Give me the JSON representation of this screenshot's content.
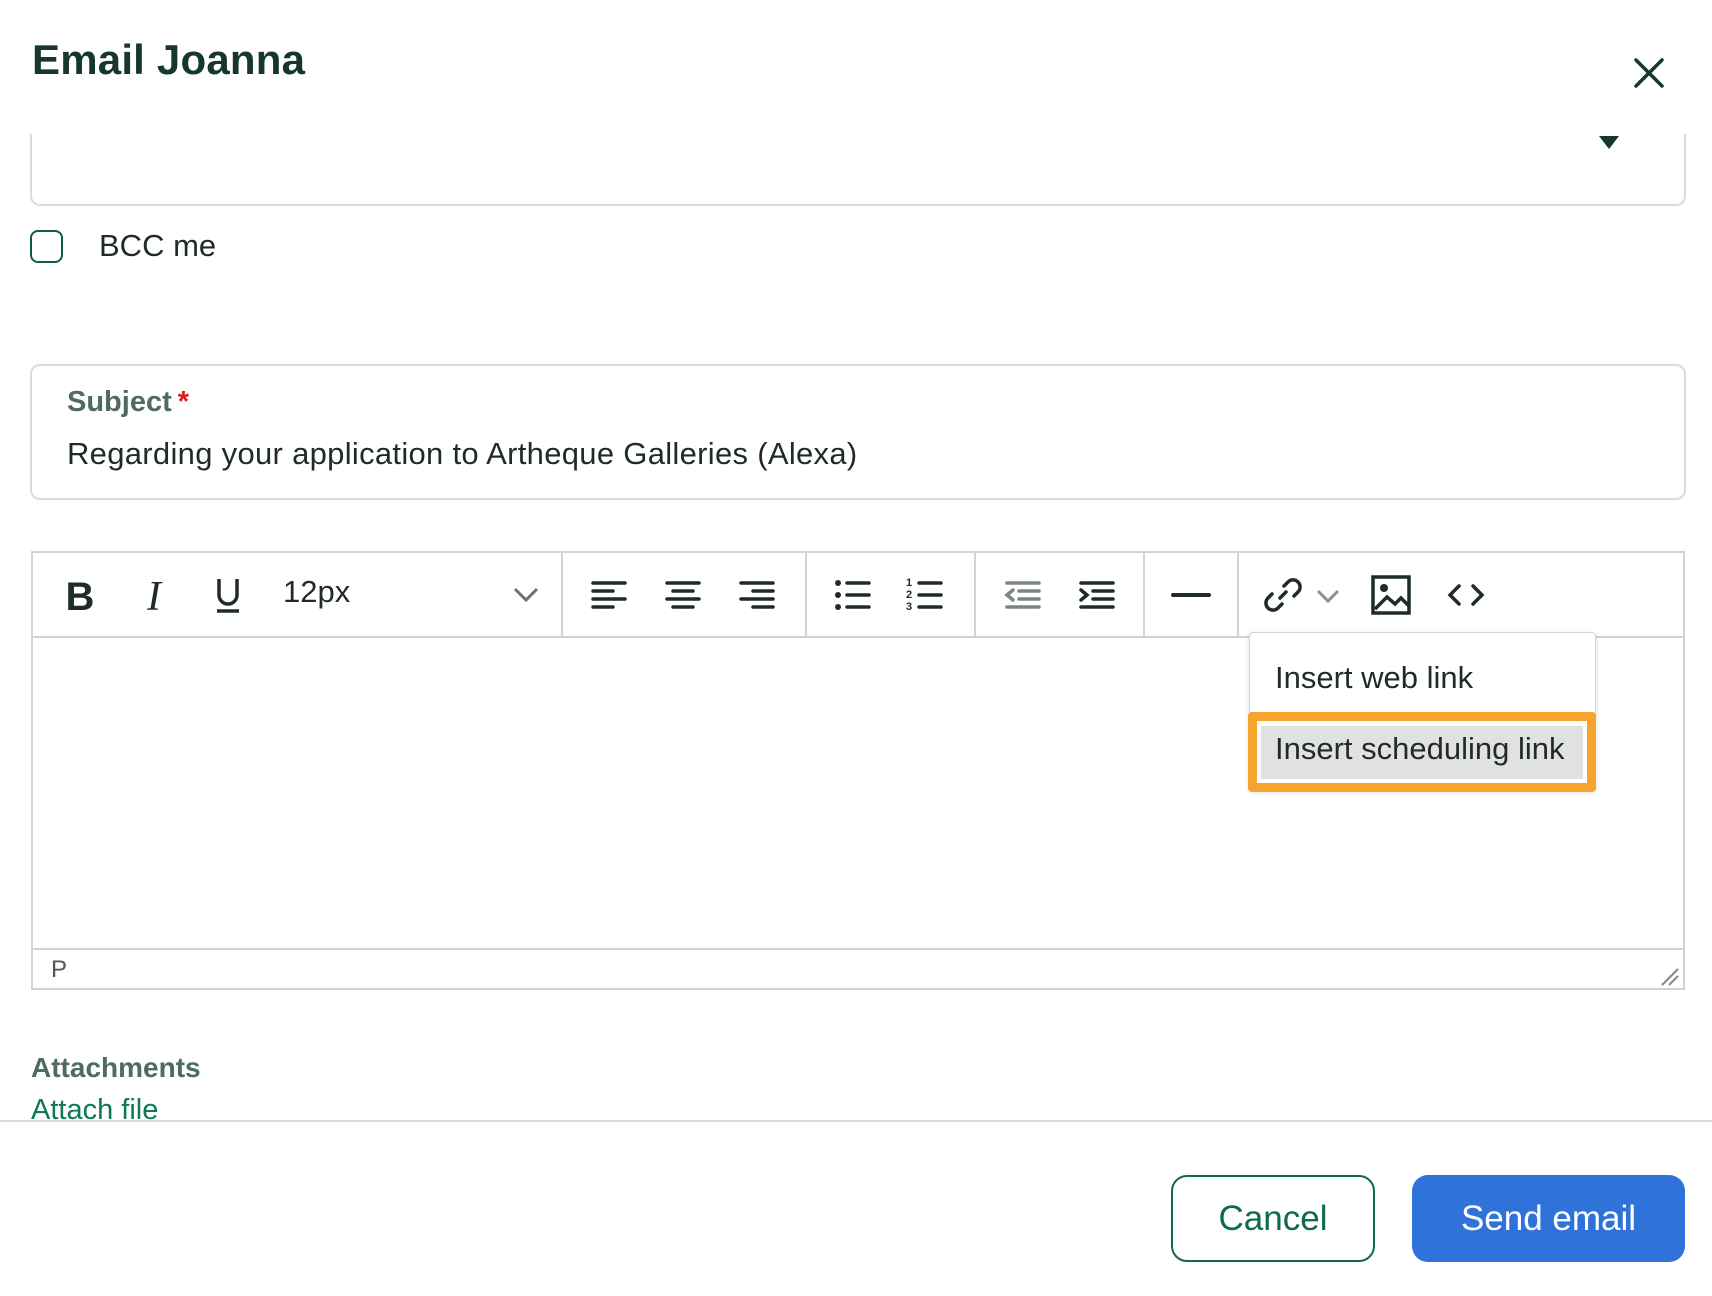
{
  "dialog": {
    "title": "Email Joanna",
    "close_icon": "close-icon"
  },
  "recipient": {
    "caret_icon": "caret-down-icon"
  },
  "bcc": {
    "label": "BCC me",
    "checked": false
  },
  "subject": {
    "label": "Subject",
    "required_marker": "*",
    "value": "Regarding your application to Artheque Galleries (Alexa)"
  },
  "editor": {
    "toolbar": {
      "bold_icon": "bold-icon",
      "italic_icon": "italic-icon",
      "underline_icon": "underline-icon",
      "font_size": "12px",
      "font_size_dropdown_icon": "chevron-down-icon",
      "align_icons": [
        "align-left-icon",
        "align-center-icon",
        "align-right-icon"
      ],
      "list_icons": [
        "bullet-list-icon",
        "numbered-list-icon"
      ],
      "indent_icons": [
        "outdent-icon",
        "indent-icon"
      ],
      "hr_icon": "horizontal-rule-icon",
      "link_icon": "link-icon",
      "image_icon": "image-icon",
      "code_icon": "code-icon"
    },
    "status_path": "P",
    "link_menu": {
      "items": [
        "Insert web link",
        "Insert scheduling link"
      ],
      "highlighted_index": 1,
      "highlight_color": "#f5a42e"
    }
  },
  "attachments": {
    "title": "Attachments",
    "link": "Attach file"
  },
  "footer": {
    "cancel_label": "Cancel",
    "send_label": "Send email",
    "send_color": "#2f72da",
    "cancel_color": "#0e6a4c"
  }
}
